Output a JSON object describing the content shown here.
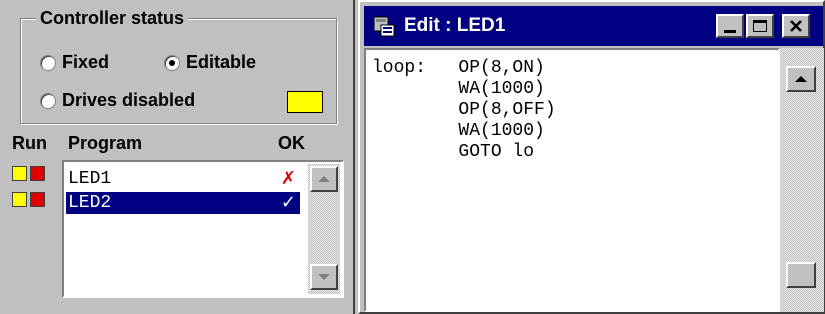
{
  "status_group": {
    "title": "Controller status",
    "options": [
      {
        "label": "Fixed",
        "selected": false
      },
      {
        "label": "Editable",
        "selected": true
      },
      {
        "label": "Drives disabled",
        "selected": false
      }
    ],
    "indicator_color": "#ffff00"
  },
  "program_table": {
    "headers": {
      "run": "Run",
      "program": "Program",
      "ok": "OK"
    },
    "rows": [
      {
        "name": "LED1",
        "ok_mark": "✗",
        "ok_color": "#e00000",
        "selected": false
      },
      {
        "name": "LED2",
        "ok_mark": "✓",
        "ok_color": "#ffffff",
        "selected": true
      }
    ]
  },
  "edit_window": {
    "title": "Edit : LED1",
    "code": "loop:   OP(8,ON)\n        WA(1000)\n        OP(8,OFF)\n        WA(1000)\n        GOTO lo"
  }
}
